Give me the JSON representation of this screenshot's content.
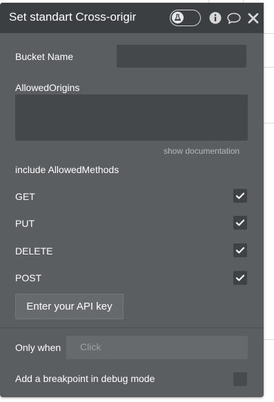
{
  "header": {
    "title": "Set standart Cross-origir",
    "icons": [
      "toggle-knob-flask-icon",
      "info-icon",
      "comment-icon",
      "close-icon"
    ]
  },
  "fields": {
    "bucket_name": {
      "label": "Bucket Name",
      "value": ""
    },
    "allowed_origins": {
      "label": "AllowedOrigins",
      "value": ""
    },
    "show_documentation": "show documentation",
    "include_methods_label": "include AllowedMethods",
    "methods": [
      {
        "label": "GET",
        "checked": true
      },
      {
        "label": "PUT",
        "checked": true
      },
      {
        "label": "DELETE",
        "checked": true
      },
      {
        "label": "POST",
        "checked": true
      }
    ],
    "api_key_button": "Enter your API key"
  },
  "footer": {
    "only_when_label": "Only when",
    "only_when_placeholder": "Click",
    "breakpoint_label": "Add a breakpoint in debug mode",
    "breakpoint_checked": false
  },
  "colors": {
    "panel_bg": "#5b5e61",
    "header_bg": "#3c3f42",
    "input_bg": "#45484b",
    "text": "#ffffff"
  }
}
